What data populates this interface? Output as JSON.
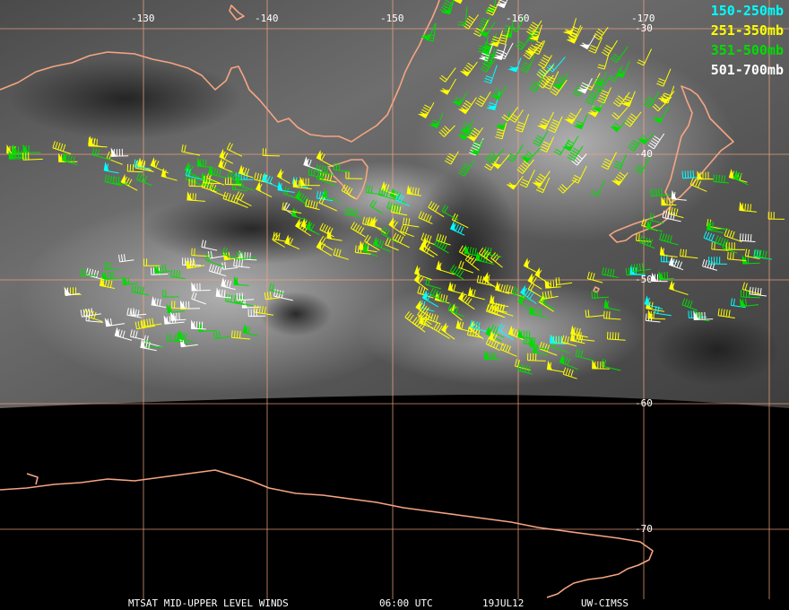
{
  "legend": [
    {
      "label": "150-250mb",
      "color": "#00ffff"
    },
    {
      "label": "251-350mb",
      "color": "#ffff00"
    },
    {
      "label": "351-500mb",
      "color": "#00dd00"
    },
    {
      "label": "501-700mb",
      "color": "#ffffff"
    }
  ],
  "longitude_labels": [
    "-130",
    "-140",
    "-150",
    "-160",
    "-170"
  ],
  "latitude_labels": [
    "-30",
    "-40",
    "-50",
    "-60",
    "-70"
  ],
  "footer": {
    "product": "MTSAT MID-UPPER LEVEL WINDS",
    "time": "06:00 UTC",
    "date": "19JUL12",
    "source": "UW-CIMSS"
  },
  "colors": {
    "coastline": "#f4a582",
    "grid": "#f4a582",
    "background": "#000000"
  }
}
